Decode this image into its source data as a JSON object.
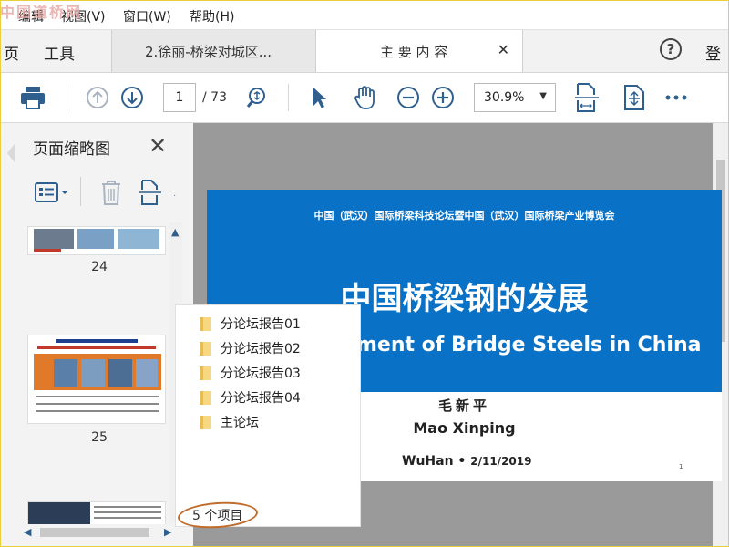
{
  "watermark": "中国道桥网",
  "menu": {
    "items": [
      "编辑",
      "视图(V)",
      "窗口(W)",
      "帮助(H)"
    ]
  },
  "tabs": {
    "home_partial": "页",
    "tools": "工具",
    "doc1": "2.徐丽-桥梁对城区...",
    "doc2": "主 要 内 容",
    "login_partial": "登"
  },
  "toolbar": {
    "page_current": "1",
    "page_total": "/ 73",
    "zoom": "30.9%"
  },
  "panel": {
    "title": "页面缩略图",
    "thumb_labels": [
      "24",
      "25"
    ]
  },
  "page": {
    "header_small": "中国（武汉）国际桥梁科技论坛暨中国（武汉）国际桥梁产业博览会",
    "title_cn": "中国桥梁钢的发展",
    "title_en": "ment of Bridge Steels in China",
    "author_cn": "毛新平",
    "author_en": "Mao Xinping",
    "place": "WuHan",
    "date": "2/11/2019",
    "page_number": "1"
  },
  "explorer": {
    "folders": [
      "分论坛报告01",
      "分论坛报告02",
      "分论坛报告03",
      "分论坛报告04",
      "主论坛"
    ],
    "status": "5 个项目"
  },
  "colors": {
    "banner": "#0a72c6",
    "status_ring": "#c06b2a",
    "folder": "#f7d780"
  }
}
